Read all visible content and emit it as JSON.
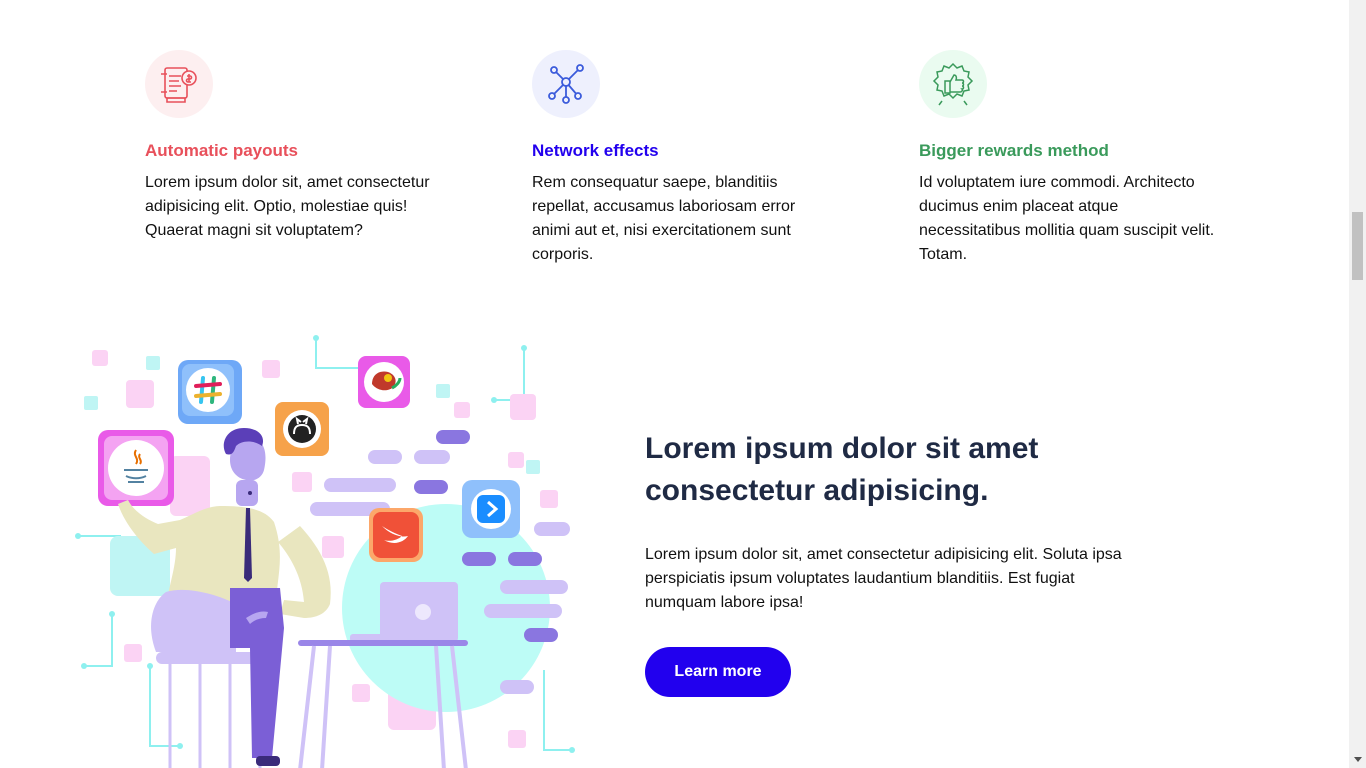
{
  "features": [
    {
      "title": "Automatic payouts",
      "text": "Lorem ipsum dolor sit, amet consectetur adipisicing elit. Optio, molestiae quis! Quaerat magni sit voluptatem?",
      "icon": "payout-document-icon",
      "color": "#e8505b",
      "bg": "#fdeff0"
    },
    {
      "title": "Network effects",
      "text": "Rem consequatur saepe, blanditiis repellat, accusamus laboriosam error animi aut et, nisi exercitationem sunt corporis.",
      "icon": "network-nodes-icon",
      "color": "#2200ee",
      "bg": "#eef0fd"
    },
    {
      "title": "Bigger rewards method",
      "text": "Id voluptatem iure commodi. Architecto ducimus enim placeat atque necessitatibus mollitia quam suscipit velit. Totam.",
      "icon": "thumbs-up-badge-icon",
      "color": "#3a9a5b",
      "bg": "#eafbf0"
    }
  ],
  "hero": {
    "title": "Lorem ipsum dolor sit amet consectetur adipisicing.",
    "text": "Lorem ipsum dolor sit, amet consectetur adipisicing elit. Soluta ipsa perspiciatis ipsum voluptates laudantium blanditiis. Est fugiat numquam labore ipsa!",
    "button_label": "Learn more",
    "button_color": "#2200ee",
    "illustration": "developer-with-app-icons-illustration"
  }
}
